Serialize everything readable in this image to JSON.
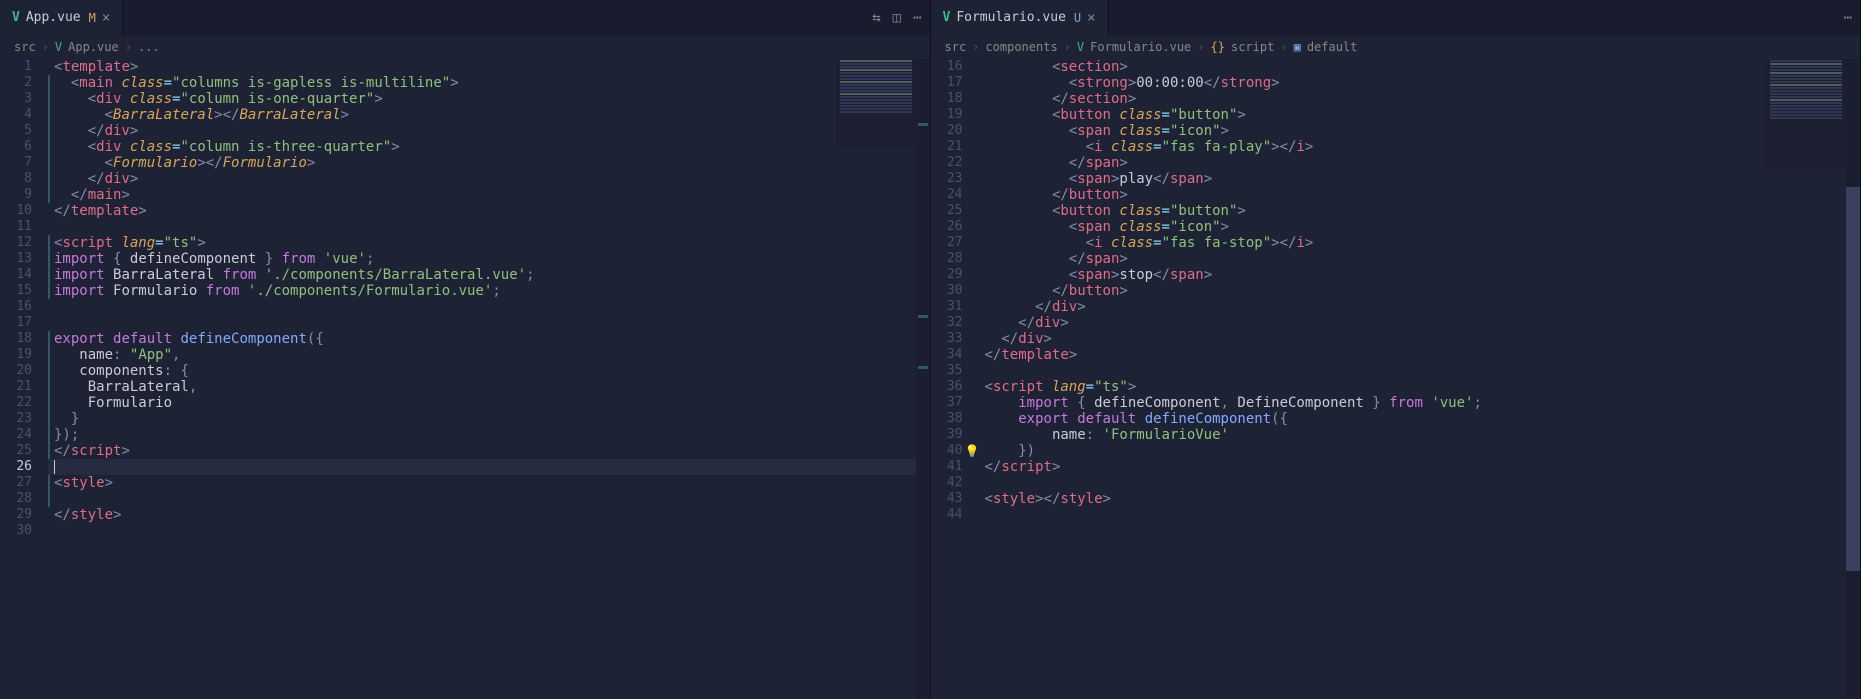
{
  "leftPane": {
    "tab": {
      "icon": "V",
      "name": "App.vue",
      "status": "M"
    },
    "actions": [
      "source-control",
      "split",
      "more"
    ],
    "breadcrumb": [
      "src",
      "App.vue",
      "..."
    ],
    "lineStart": 1,
    "lineEnd": 30,
    "currentLine": 26
  },
  "rightPane": {
    "tab": {
      "icon": "V",
      "name": "Formulario.vue",
      "status": "U"
    },
    "breadcrumb": [
      "src",
      "components",
      "Formulario.vue",
      "script",
      "default"
    ],
    "lineStart": 16,
    "lineEnd": 44,
    "lightbulbLine": 40
  },
  "leftCode": [
    {
      "n": 1,
      "c": false,
      "html": "<span class='pun'>&lt;</span><span class='tag'>template</span><span class='pun'>&gt;</span>"
    },
    {
      "n": 2,
      "c": true,
      "html": "  <span class='pun'>&lt;</span><span class='tag'>main</span> <span class='attr'>class</span><span class='op'>=</span><span class='str'>\"columns is-gapless is-multiline\"</span><span class='pun'>&gt;</span>"
    },
    {
      "n": 3,
      "c": true,
      "html": "    <span class='pun'>&lt;</span><span class='tag'>div</span> <span class='attr'>class</span><span class='op'>=</span><span class='str'>\"column is-one-quarter\"</span><span class='pun'>&gt;</span>"
    },
    {
      "n": 4,
      "c": true,
      "html": "      <span class='pun'>&lt;</span><span class='attr'>BarraLateral</span><span class='pun'>&gt;&lt;/</span><span class='attr'>BarraLateral</span><span class='pun'>&gt;</span>"
    },
    {
      "n": 5,
      "c": true,
      "html": "    <span class='pun'>&lt;/</span><span class='tag'>div</span><span class='pun'>&gt;</span>"
    },
    {
      "n": 6,
      "c": true,
      "html": "    <span class='pun'>&lt;</span><span class='tag'>div</span> <span class='attr'>class</span><span class='op'>=</span><span class='str'>\"column is-three-quarter\"</span><span class='pun'>&gt;</span>"
    },
    {
      "n": 7,
      "c": true,
      "html": "      <span class='pun'>&lt;</span><span class='attr'>Formulario</span><span class='pun'>&gt;&lt;/</span><span class='attr'>Formulario</span><span class='pun'>&gt;</span>"
    },
    {
      "n": 8,
      "c": true,
      "html": "    <span class='pun'>&lt;/</span><span class='tag'>div</span><span class='pun'>&gt;</span>"
    },
    {
      "n": 9,
      "c": true,
      "html": "  <span class='pun'>&lt;/</span><span class='tag'>main</span><span class='pun'>&gt;</span>"
    },
    {
      "n": 10,
      "c": false,
      "html": "<span class='pun'>&lt;/</span><span class='tag'>template</span><span class='pun'>&gt;</span>"
    },
    {
      "n": 11,
      "c": false,
      "html": ""
    },
    {
      "n": 12,
      "c": true,
      "html": "<span class='pun'>&lt;</span><span class='tag'>script</span> <span class='attr'>lang</span><span class='op'>=</span><span class='str'>\"ts\"</span><span class='pun'>&gt;</span>"
    },
    {
      "n": 13,
      "c": true,
      "html": "<span class='kw'>import</span> <span class='pun'>{</span> <span class='id'>defineComponent</span> <span class='pun'>}</span> <span class='kw'>from</span> <span class='str'>'vue'</span><span class='pun'>;</span>"
    },
    {
      "n": 14,
      "c": true,
      "html": "<span class='kw'>import</span> <span class='id'>BarraLateral</span> <span class='kw'>from</span> <span class='str'>'./components/BarraLateral.vue'</span><span class='pun'>;</span>"
    },
    {
      "n": 15,
      "c": true,
      "html": "<span class='kw'>import</span> <span class='id'>Formulario</span> <span class='kw'>from</span> <span class='str'>'./components/Formulario.vue'</span><span class='pun'>;</span>"
    },
    {
      "n": 16,
      "c": false,
      "html": ""
    },
    {
      "n": 17,
      "c": false,
      "html": ""
    },
    {
      "n": 18,
      "c": true,
      "html": "<span class='kw'>export</span> <span class='kw'>default</span> <span class='fn'>defineComponent</span><span class='pun'>({</span>"
    },
    {
      "n": 19,
      "c": true,
      "html": "   <span class='id'>name</span><span class='pun'>:</span> <span class='str'>\"App\"</span><span class='pun'>,</span>"
    },
    {
      "n": 20,
      "c": true,
      "html": "   <span class='id'>components</span><span class='pun'>:</span> <span class='pun'>{</span>"
    },
    {
      "n": 21,
      "c": true,
      "html": "    <span class='id'>BarraLateral</span><span class='pun'>,</span>"
    },
    {
      "n": 22,
      "c": true,
      "html": "    <span class='id'>Formulario</span>"
    },
    {
      "n": 23,
      "c": true,
      "html": "  <span class='pun'>}</span>"
    },
    {
      "n": 24,
      "c": true,
      "html": "<span class='pun'>});</span>"
    },
    {
      "n": 25,
      "c": true,
      "html": "<span class='pun'>&lt;/</span><span class='tag'>script</span><span class='pun'>&gt;</span>"
    },
    {
      "n": 26,
      "c": false,
      "html": "",
      "current": true
    },
    {
      "n": 27,
      "c": true,
      "html": "<span class='pun'>&lt;</span><span class='tag'>style</span><span class='pun'>&gt;</span>"
    },
    {
      "n": 28,
      "c": true,
      "html": ""
    },
    {
      "n": 29,
      "c": false,
      "html": "<span class='pun'>&lt;/</span><span class='tag'>style</span><span class='pun'>&gt;</span>"
    },
    {
      "n": 30,
      "c": false,
      "html": ""
    }
  ],
  "rightCode": [
    {
      "n": 16,
      "html": "        <span class='pun'>&lt;</span><span class='tag'>section</span><span class='pun'>&gt;</span>"
    },
    {
      "n": 17,
      "html": "          <span class='pun'>&lt;</span><span class='tag'>strong</span><span class='pun'>&gt;</span><span class='id'>00:00:00</span><span class='pun'>&lt;/</span><span class='tag'>strong</span><span class='pun'>&gt;</span>"
    },
    {
      "n": 18,
      "html": "        <span class='pun'>&lt;/</span><span class='tag'>section</span><span class='pun'>&gt;</span>"
    },
    {
      "n": 19,
      "html": "        <span class='pun'>&lt;</span><span class='tag'>button</span> <span class='attr'>class</span><span class='op'>=</span><span class='str'>\"button\"</span><span class='pun'>&gt;</span>"
    },
    {
      "n": 20,
      "html": "          <span class='pun'>&lt;</span><span class='tag'>span</span> <span class='attr'>class</span><span class='op'>=</span><span class='str'>\"icon\"</span><span class='pun'>&gt;</span>"
    },
    {
      "n": 21,
      "html": "            <span class='pun'>&lt;</span><span class='tag'>i</span> <span class='attr'>class</span><span class='op'>=</span><span class='str'>\"fas fa-play\"</span><span class='pun'>&gt;&lt;/</span><span class='tag'>i</span><span class='pun'>&gt;</span>"
    },
    {
      "n": 22,
      "html": "          <span class='pun'>&lt;/</span><span class='tag'>span</span><span class='pun'>&gt;</span>"
    },
    {
      "n": 23,
      "html": "          <span class='pun'>&lt;</span><span class='tag'>span</span><span class='pun'>&gt;</span><span class='id'>play</span><span class='pun'>&lt;/</span><span class='tag'>span</span><span class='pun'>&gt;</span>"
    },
    {
      "n": 24,
      "html": "        <span class='pun'>&lt;/</span><span class='tag'>button</span><span class='pun'>&gt;</span>"
    },
    {
      "n": 25,
      "html": "        <span class='pun'>&lt;</span><span class='tag'>button</span> <span class='attr'>class</span><span class='op'>=</span><span class='str'>\"button\"</span><span class='pun'>&gt;</span>"
    },
    {
      "n": 26,
      "html": "          <span class='pun'>&lt;</span><span class='tag'>span</span> <span class='attr'>class</span><span class='op'>=</span><span class='str'>\"icon\"</span><span class='pun'>&gt;</span>"
    },
    {
      "n": 27,
      "html": "            <span class='pun'>&lt;</span><span class='tag'>i</span> <span class='attr'>class</span><span class='op'>=</span><span class='str'>\"fas fa-stop\"</span><span class='pun'>&gt;&lt;/</span><span class='tag'>i</span><span class='pun'>&gt;</span>"
    },
    {
      "n": 28,
      "html": "          <span class='pun'>&lt;/</span><span class='tag'>span</span><span class='pun'>&gt;</span>"
    },
    {
      "n": 29,
      "html": "          <span class='pun'>&lt;</span><span class='tag'>span</span><span class='pun'>&gt;</span><span class='id'>stop</span><span class='pun'>&lt;/</span><span class='tag'>span</span><span class='pun'>&gt;</span>"
    },
    {
      "n": 30,
      "html": "        <span class='pun'>&lt;/</span><span class='tag'>button</span><span class='pun'>&gt;</span>"
    },
    {
      "n": 31,
      "html": "      <span class='pun'>&lt;/</span><span class='tag'>div</span><span class='pun'>&gt;</span>"
    },
    {
      "n": 32,
      "html": "    <span class='pun'>&lt;/</span><span class='tag'>div</span><span class='pun'>&gt;</span>"
    },
    {
      "n": 33,
      "html": "  <span class='pun'>&lt;/</span><span class='tag'>div</span><span class='pun'>&gt;</span>"
    },
    {
      "n": 34,
      "html": "<span class='pun'>&lt;/</span><span class='tag'>template</span><span class='pun'>&gt;</span>"
    },
    {
      "n": 35,
      "html": ""
    },
    {
      "n": 36,
      "html": "<span class='pun'>&lt;</span><span class='tag'>script</span> <span class='attr'>lang</span><span class='op'>=</span><span class='str'>\"ts\"</span><span class='pun'>&gt;</span>"
    },
    {
      "n": 37,
      "html": "    <span class='kw'>import</span> <span class='pun'>{</span> <span class='id'>defineComponent</span><span class='pun'>,</span> <span class='id'>DefineComponent</span> <span class='pun'>}</span> <span class='kw'>from</span> <span class='str'>'vue'</span><span class='pun'>;</span>"
    },
    {
      "n": 38,
      "html": "    <span class='kw'>export</span> <span class='kw'>default</span> <span class='fn'>defineComponent</span><span class='pun'>({</span>"
    },
    {
      "n": 39,
      "html": "        <span class='id'>name</span><span class='pun'>:</span> <span class='str'>'FormularioVue'</span>"
    },
    {
      "n": 40,
      "html": "    <span class='pun'>})</span>",
      "bulb": true
    },
    {
      "n": 41,
      "html": "<span class='pun'>&lt;/</span><span class='tag'>script</span><span class='pun'>&gt;</span>"
    },
    {
      "n": 42,
      "html": ""
    },
    {
      "n": 43,
      "html": "<span class='pun'>&lt;</span><span class='tag'>style</span><span class='pun'>&gt;&lt;/</span><span class='tag'>style</span><span class='pun'>&gt;</span>"
    },
    {
      "n": 44,
      "html": ""
    }
  ]
}
